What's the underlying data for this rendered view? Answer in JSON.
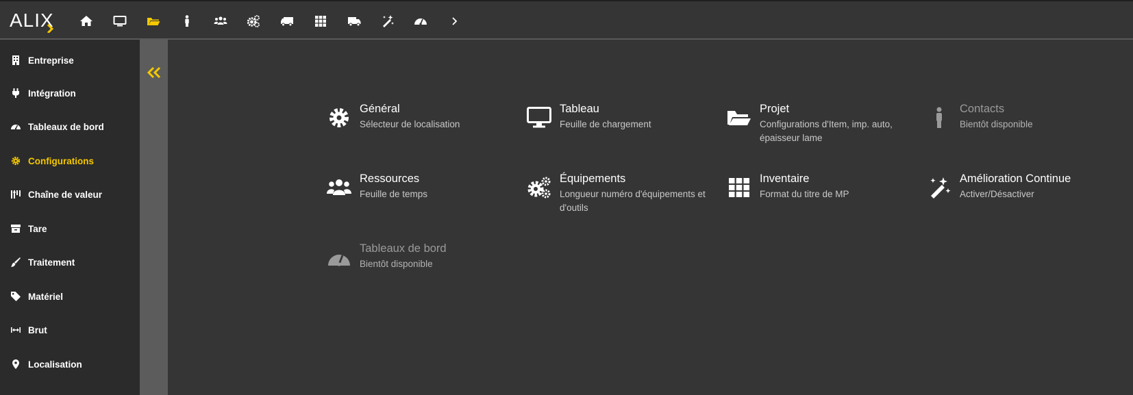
{
  "colors": {
    "accent": "#f5c800",
    "background": "#353535",
    "sidebar": "#2b2b2b",
    "strip": "#5c5c5c",
    "disabled": "#9a9a9a"
  },
  "logo": {
    "text": "ALIX"
  },
  "topnav": [
    {
      "icon": "home-icon"
    },
    {
      "icon": "monitor-icon"
    },
    {
      "icon": "folder-open-icon",
      "active": true
    },
    {
      "icon": "person-icon"
    },
    {
      "icon": "users-icon"
    },
    {
      "icon": "gears-icon"
    },
    {
      "icon": "truck-icon"
    },
    {
      "icon": "grid-icon"
    },
    {
      "icon": "delivery-truck-icon"
    },
    {
      "icon": "magic-wand-icon"
    },
    {
      "icon": "gauge-icon"
    },
    {
      "icon": "chevron-right-icon"
    }
  ],
  "sidebar": {
    "items": [
      {
        "label": "Entreprise",
        "icon": "building-icon"
      },
      {
        "label": "Intégration",
        "icon": "plug-icon"
      },
      {
        "label": "Tableaux de bord",
        "icon": "gauge-icon"
      },
      {
        "label": "Configurations",
        "icon": "gear-icon",
        "active": true
      },
      {
        "label": "Chaîne de valeur",
        "icon": "value-chain-icon"
      },
      {
        "label": "Tare",
        "icon": "archive-box-icon"
      },
      {
        "label": "Traitement",
        "icon": "brush-icon"
      },
      {
        "label": "Matériel",
        "icon": "tag-icon"
      },
      {
        "label": "Brut",
        "icon": "width-arrows-icon"
      },
      {
        "label": "Localisation",
        "icon": "map-pin-icon"
      }
    ]
  },
  "collapse": {
    "icon": "double-chevron-left-icon"
  },
  "cards": [
    {
      "title": "Général",
      "desc": "Sélecteur de localisation",
      "icon": "gear-icon",
      "disabled": false
    },
    {
      "title": "Tableau",
      "desc": "Feuille de chargement",
      "icon": "monitor-icon",
      "disabled": false
    },
    {
      "title": "Projet",
      "desc": "Configurations d'Item, imp. auto, épaisseur lame",
      "icon": "folder-open-icon",
      "disabled": false
    },
    {
      "title": "Contacts",
      "desc": "Bientôt disponible",
      "icon": "person-icon",
      "disabled": true
    },
    {
      "title": "Ressources",
      "desc": "Feuille de temps",
      "icon": "users-icon",
      "disabled": false
    },
    {
      "title": "Équipements",
      "desc": "Longueur numéro d'équipements et d'outils",
      "icon": "gears-icon",
      "disabled": false
    },
    {
      "title": "Inventaire",
      "desc": "Format du titre de MP",
      "icon": "grid-icon",
      "disabled": false
    },
    {
      "title": "Amélioration Continue",
      "desc": "Activer/Désactiver",
      "icon": "magic-wand-icon",
      "disabled": false
    },
    {
      "title": "Tableaux de bord",
      "desc": "Bientôt disponible",
      "icon": "gauge-icon",
      "disabled": true
    }
  ]
}
